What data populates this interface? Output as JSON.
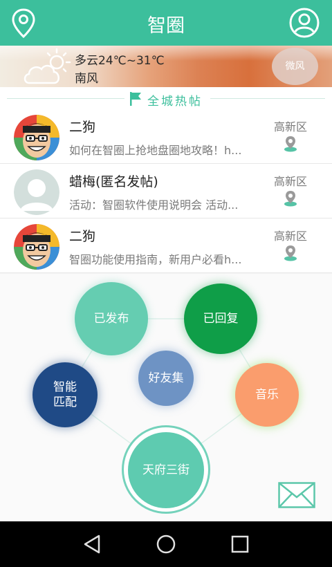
{
  "header": {
    "title": "智圈"
  },
  "weather": {
    "condition_temp": "多云24℃~31℃",
    "wind": "南风",
    "wind_button": "微风"
  },
  "section": {
    "title": "全城热帖"
  },
  "posts": [
    {
      "name": "二狗",
      "preview": "如何在智圈上抢地盘圈地攻略！h...",
      "area": "高新区"
    },
    {
      "name": "蜡梅(匿名发帖)",
      "preview": "活动：智圈软件使用说明会 活动...",
      "area": "高新区"
    },
    {
      "name": "二狗",
      "preview": "智圈功能使用指南，新用户必看h...",
      "area": "高新区"
    }
  ],
  "bubbles": {
    "published": "已发布",
    "replied": "已回复",
    "friends": "好友集",
    "match_line1": "智能",
    "match_line2": "匹配",
    "music": "音乐",
    "street": "天府三街"
  },
  "colors": {
    "accent": "#3cbf9c",
    "replied": "#0f9e48",
    "match": "#1f4a86",
    "friends": "#6e93c4",
    "music": "#fa9d6d"
  }
}
